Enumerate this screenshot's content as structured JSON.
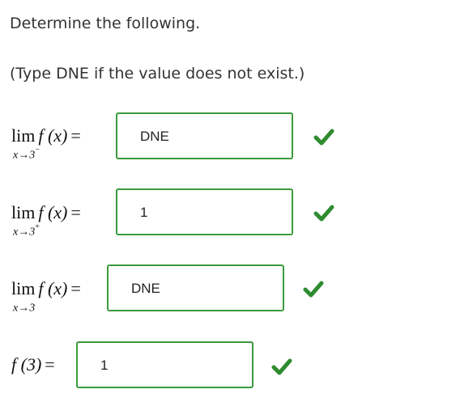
{
  "instructions": {
    "line1": "Determine the following.",
    "line2": "(Type DNE if the value does not exist.)"
  },
  "items": [
    {
      "lim": "lim",
      "fx": "f (x)",
      "eq": "=",
      "approach": "x→3",
      "sup": "−",
      "answer": "DNE"
    },
    {
      "lim": "lim",
      "fx": "f (x)",
      "eq": "=",
      "approach": "x→3",
      "sup": "+",
      "answer": "1"
    },
    {
      "lim": "lim",
      "fx": "f (x)",
      "eq": "=",
      "approach": "x→3",
      "sup": "",
      "answer": "DNE"
    },
    {
      "fx": "f (3)",
      "eq": "=",
      "answer": "1"
    }
  ],
  "status": {
    "correct_icon": "checkmark-icon",
    "correct_color": "#2e8b2e",
    "border_color": "#3c9a3c"
  }
}
